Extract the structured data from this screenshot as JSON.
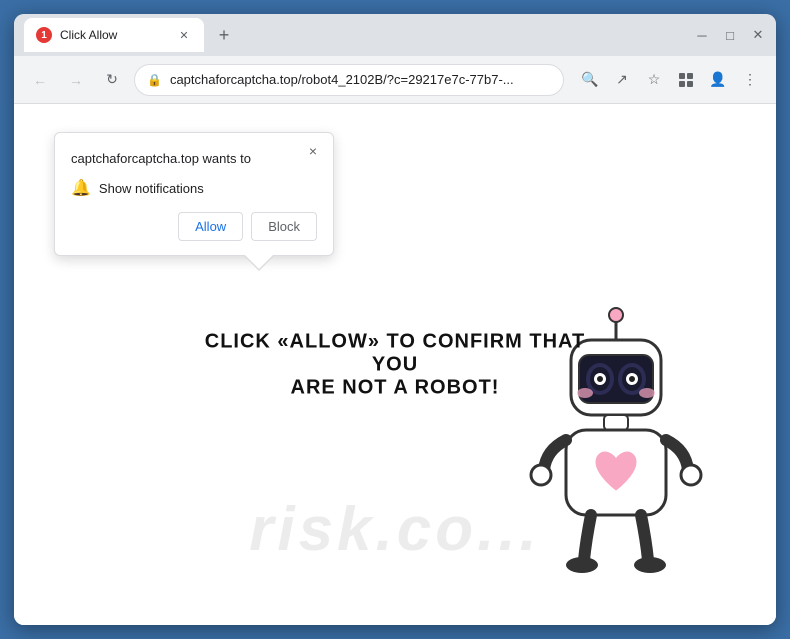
{
  "browser": {
    "title": "Click Allow",
    "tab": {
      "label": "Click Allow",
      "favicon": "1"
    },
    "address": "captchaforcaptcha.top/robot4_2102B/?c=29217e7c-77b7-...",
    "new_tab_icon": "+",
    "window_controls": {
      "minimize": "─",
      "maximize": "□",
      "close": "✕"
    },
    "nav": {
      "back": "←",
      "forward": "→",
      "reload": "↻"
    }
  },
  "popup": {
    "title": "captchaforcaptcha.top wants to",
    "notification_label": "Show notifications",
    "allow_label": "Allow",
    "block_label": "Block",
    "close_label": "×"
  },
  "page": {
    "line1": "CLICK «ALLOW» TO CONFIRM THAT YOU",
    "line2": "ARE NOT A ROBOT!",
    "watermark": "risk.co..."
  }
}
